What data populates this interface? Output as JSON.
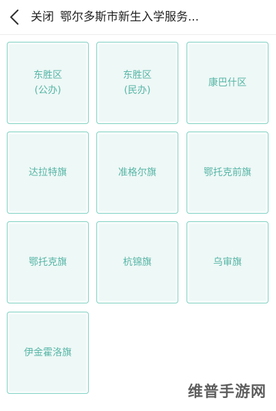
{
  "header": {
    "back_icon": "chevron-left-icon",
    "close_label": "关闭",
    "title": "鄂尔多斯市新生入学服务..."
  },
  "districts": [
    {
      "line1": "东胜区",
      "line2": "(公办)"
    },
    {
      "line1": "东胜区",
      "line2": "(民办)"
    },
    {
      "line1": "康巴什区",
      "line2": ""
    },
    {
      "line1": "达拉特旗",
      "line2": ""
    },
    {
      "line1": "准格尔旗",
      "line2": ""
    },
    {
      "line1": "鄂托克前旗",
      "line2": ""
    },
    {
      "line1": "鄂托克旗",
      "line2": ""
    },
    {
      "line1": "杭锦旗",
      "line2": ""
    },
    {
      "line1": "乌审旗",
      "line2": ""
    },
    {
      "line1": "伊金霍洛旗",
      "line2": ""
    }
  ],
  "colors": {
    "card_border": "#7fd1c3",
    "card_background": "#eef8f6",
    "card_text": "#56b5a6"
  },
  "watermark": "维普手游网"
}
